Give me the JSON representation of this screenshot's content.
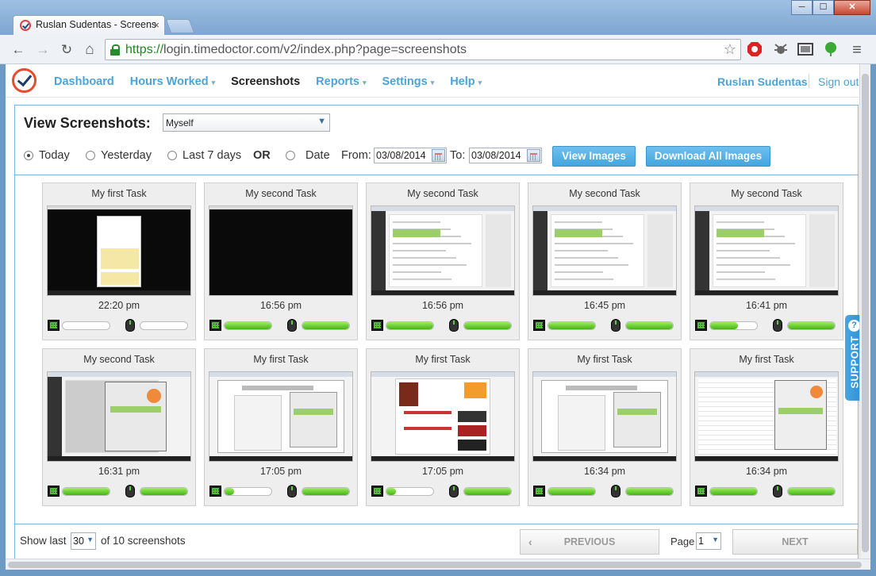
{
  "browser": {
    "tab_title": "Ruslan Sudentas - Screens",
    "tab_close": "×",
    "url_scheme": "https://",
    "url_rest": "login.timedoctor.com/v2/index.php?page=screenshots",
    "min": "─",
    "max": "☐",
    "close": "✕",
    "back": "←",
    "forward": "→",
    "reload": "↻",
    "home": "⌂",
    "star": "☆",
    "menu": "≡"
  },
  "nav": {
    "items": [
      {
        "label": "Dashboard",
        "caret": ""
      },
      {
        "label": "Hours Worked",
        "caret": "▾"
      },
      {
        "label": "Screenshots",
        "caret": ""
      },
      {
        "label": "Reports",
        "caret": "▾"
      },
      {
        "label": "Settings",
        "caret": "▾"
      },
      {
        "label": "Help",
        "caret": "▾"
      }
    ],
    "user": "Ruslan Sudentas",
    "signout": "Sign out"
  },
  "controls": {
    "title": "View Screenshots:",
    "who": "Myself",
    "today": "Today",
    "yesterday": "Yesterday",
    "last7": "Last 7 days",
    "or": "OR",
    "date": "Date",
    "from_label": "From:",
    "from_value": "03/08/2014",
    "to_label": "To:",
    "to_value": "03/08/2014",
    "view_images": "View Images",
    "download_all": "Download All Images"
  },
  "screenshots": [
    {
      "task": "My first Task",
      "time": "22:20 pm",
      "kb": 0.0,
      "mouse": 0.0,
      "style": "dark-popup"
    },
    {
      "task": "My second Task",
      "time": "16:56 pm",
      "kb": 1.0,
      "mouse": 1.0,
      "style": "dark"
    },
    {
      "task": "My second Task",
      "time": "16:56 pm",
      "kb": 1.0,
      "mouse": 1.0,
      "style": "editor"
    },
    {
      "task": "My second Task",
      "time": "16:45 pm",
      "kb": 1.0,
      "mouse": 1.0,
      "style": "editor"
    },
    {
      "task": "My second Task",
      "time": "16:41 pm",
      "kb": 0.6,
      "mouse": 1.0,
      "style": "editor"
    },
    {
      "task": "My second Task",
      "time": "16:31 pm",
      "kb": 1.0,
      "mouse": 1.0,
      "style": "app"
    },
    {
      "task": "My first Task",
      "time": "17:05 pm",
      "kb": 0.2,
      "mouse": 1.0,
      "style": "browser"
    },
    {
      "task": "My first Task",
      "time": "17:05 pm",
      "kb": 0.2,
      "mouse": 1.0,
      "style": "shop"
    },
    {
      "task": "My first Task",
      "time": "16:34 pm",
      "kb": 1.0,
      "mouse": 1.0,
      "style": "browser"
    },
    {
      "task": "My first Task",
      "time": "16:34 pm",
      "kb": 1.0,
      "mouse": 1.0,
      "style": "sheet"
    }
  ],
  "footer": {
    "show_last": "Show last",
    "per_page": "30",
    "of_text": "of 10 screenshots",
    "previous": "PREVIOUS",
    "page_label": "Page",
    "page_value": "1",
    "next": "NEXT"
  },
  "support": {
    "label": "SUPPORT",
    "q": "?"
  },
  "colors": {
    "accent": "#4ba4d8",
    "button": "#44a5de",
    "activity": "#45b315"
  }
}
